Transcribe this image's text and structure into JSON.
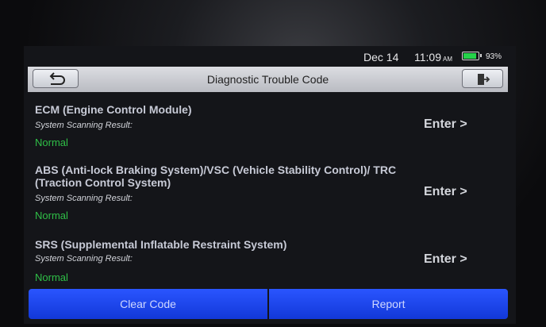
{
  "status_bar": {
    "date": "Dec 14",
    "time": "11:09",
    "ampm": "AM",
    "battery_percent_label": "93%",
    "battery_level": 0.93,
    "battery_color": "#25d34a"
  },
  "header": {
    "title": "Diagnostic Trouble Code",
    "back_icon": "back-arrow-icon",
    "exit_icon": "exit-icon"
  },
  "systems": [
    {
      "name": "ECM (Engine Control Module)",
      "result_label": "System Scanning Result:",
      "result": "Normal",
      "action": "Enter >"
    },
    {
      "name": "ABS (Anti-lock Braking System)/VSC (Vehicle Stability Control)/ TRC (Traction Control System)",
      "result_label": "System Scanning Result:",
      "result": "Normal",
      "action": "Enter >"
    },
    {
      "name": "SRS (Supplemental Inflatable Restraint System)",
      "result_label": "System Scanning Result:",
      "result": "Normal",
      "action": "Enter >"
    }
  ],
  "footer": {
    "clear_code_label": "Clear Code",
    "report_label": "Report",
    "accent_color": "#1f46f0"
  },
  "colors": {
    "normal_status": "#2fbf47"
  }
}
